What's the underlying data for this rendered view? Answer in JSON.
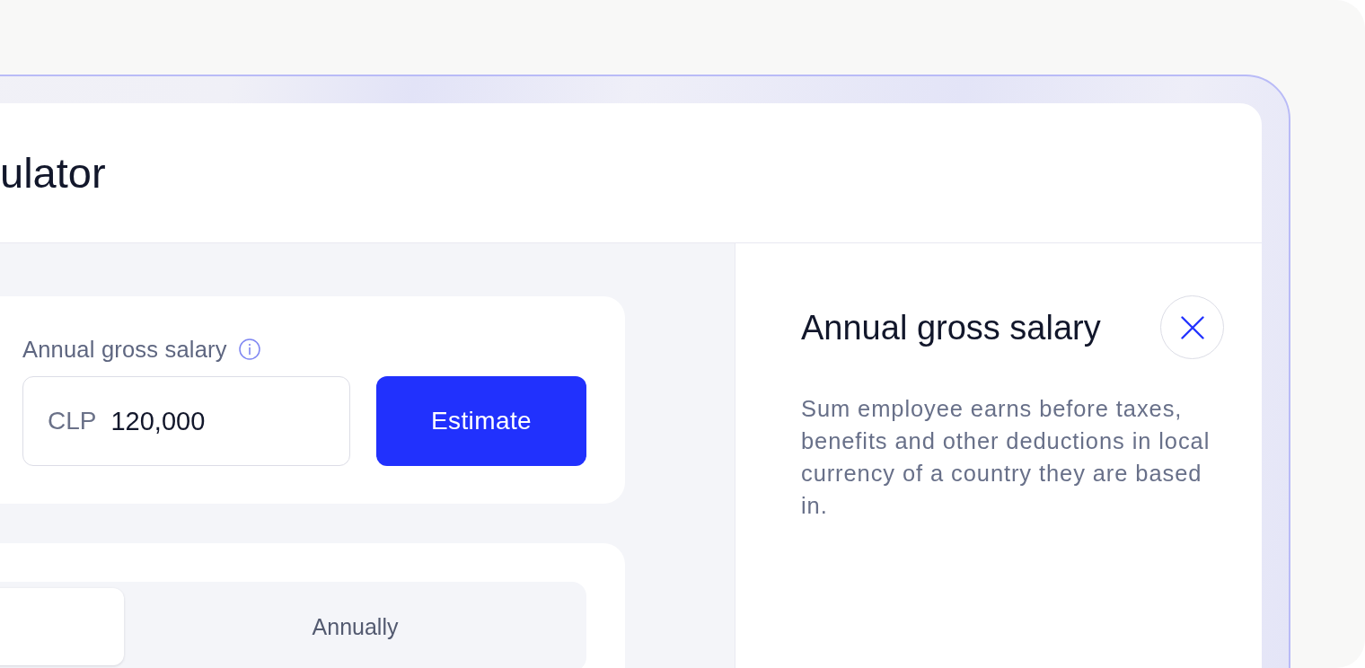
{
  "header": {
    "title": "ulator"
  },
  "salary_card": {
    "label": "Annual gross salary",
    "field": {
      "prefix": "CLP",
      "value": "120,000"
    },
    "button": "Estimate"
  },
  "period_card": {
    "segments": [
      {
        "selected": true
      },
      {
        "label": "Annually",
        "selected": false
      }
    ]
  },
  "info_panel": {
    "title": "Annual gross salary",
    "description": "Sum employee earns before taxes, benefits and other deductions in local currency of a country they are based in."
  }
}
